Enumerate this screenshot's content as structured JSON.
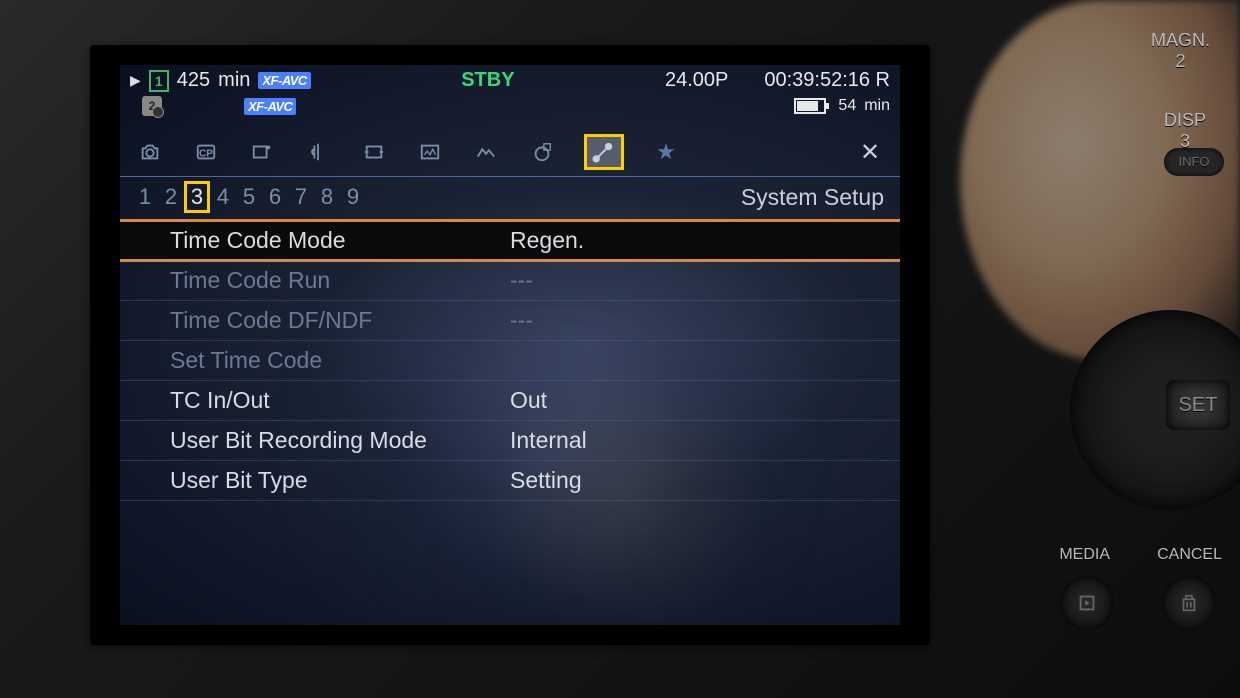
{
  "status": {
    "slot1_number": "1",
    "rec_time": "425",
    "rec_unit": "min",
    "codec1": "XF-AVC",
    "codec2": "XF-AVC",
    "slot2_number": "2",
    "state": "STBY",
    "frame_rate": "24.00P",
    "timecode": "00:39:52:16 R",
    "battery_time": "54",
    "battery_unit": "min"
  },
  "tabs": {
    "title": "System Setup"
  },
  "pages": [
    "1",
    "2",
    "3",
    "4",
    "5",
    "6",
    "7",
    "8",
    "9"
  ],
  "active_page_index": 2,
  "menu": [
    {
      "label": "Time Code Mode",
      "value": "Regen.",
      "state": "selected"
    },
    {
      "label": "Time Code Run",
      "value": "---",
      "state": "disabled"
    },
    {
      "label": "Time Code DF/NDF",
      "value": "---",
      "state": "disabled"
    },
    {
      "label": "Set Time Code",
      "value": "",
      "state": "disabled"
    },
    {
      "label": "TC In/Out",
      "value": "Out",
      "state": "normal"
    },
    {
      "label": "User Bit Recording Mode",
      "value": "Internal",
      "state": "normal"
    },
    {
      "label": "User Bit Type",
      "value": "Setting",
      "state": "normal"
    }
  ],
  "hw": {
    "magn_label": "MAGN.",
    "magn_num": "2",
    "disp_label": "DISP",
    "disp_num": "3",
    "info": "INFO",
    "set": "SET",
    "media": "MEDIA",
    "cancel": "CANCEL"
  }
}
